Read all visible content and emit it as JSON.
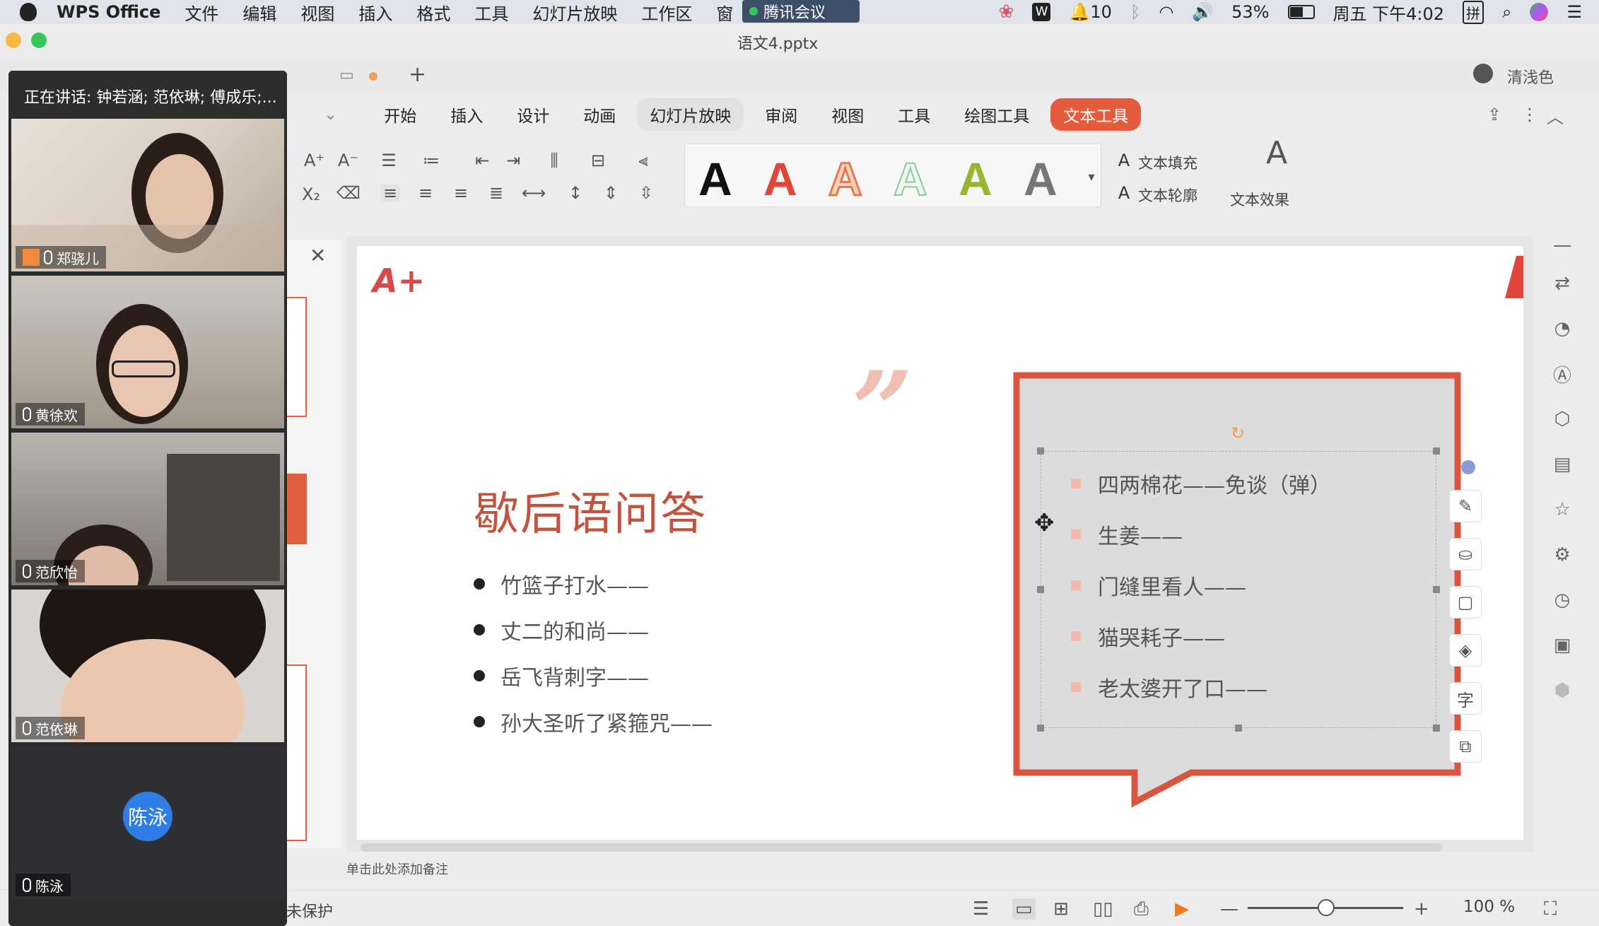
{
  "menubar": {
    "app": "WPS Office",
    "items": [
      "文件",
      "编辑",
      "视图",
      "插入",
      "格式",
      "工具",
      "幻灯片放映",
      "工作区",
      "窗"
    ],
    "meeting_app": "腾讯会议",
    "notification_count": "10",
    "battery": "53%",
    "clock": "周五 下午4:02",
    "input_method": "拼"
  },
  "window": {
    "title": "语文4.pptx"
  },
  "tabbar": {
    "user": "清浅色"
  },
  "ribbon": {
    "tabs": [
      "开始",
      "插入",
      "设计",
      "动画",
      "幻灯片放映",
      "审阅",
      "视图",
      "工具",
      "绘图工具",
      "文本工具"
    ],
    "selected_tab": "幻灯片放映",
    "accent_tab": "文本工具",
    "text_fill": "文本填充",
    "text_outline": "文本轮廓",
    "text_effect": "文本效果",
    "style_letter": "A"
  },
  "slide": {
    "title": "歇后语问答",
    "left_bullets": [
      "竹篮子打水——",
      "丈二的和尚——",
      "岳飞背刺字——",
      "孙大圣听了紧箍咒——"
    ],
    "right_bullets": [
      "四两棉花——免谈（弹）",
      "生姜——",
      "门缝里看人——",
      "猫哭耗子——",
      "老太婆开了口——"
    ],
    "badge": "A+"
  },
  "notes_placeholder": "单击此处添加备注",
  "statusbar": {
    "protect": "未保护",
    "zoom": "100 %"
  },
  "meeting": {
    "speaking": "正在讲话: 钟若涵; 范依琳; 傅成乐;...",
    "participants": [
      "郑骁儿",
      "黄徐欢",
      "范欣怡",
      "范依琳",
      "陈泳"
    ],
    "avatar_text": "陈泳"
  },
  "colors": {
    "accent": "#e55b3c",
    "title_red": "#c2533e",
    "bubble_border": "#d9553f",
    "bubble_fill": "#dcdcdc",
    "meeting_avatar": "#2f7ee6"
  }
}
